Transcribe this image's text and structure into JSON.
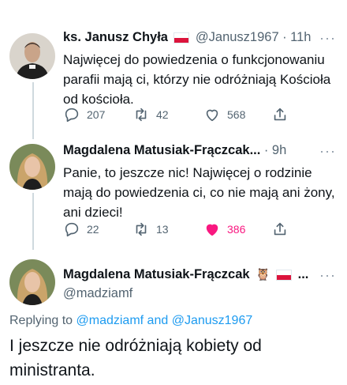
{
  "tweets": [
    {
      "name": "ks. Janusz Chyła",
      "handle": "@Janusz1967",
      "time": "· 11h",
      "text": "Najwięcej do powiedzenia o funkcjonowaniu parafii mają ci, którzy nie odróżniają Kościoła od kościoła.",
      "replies": "207",
      "retweets": "42",
      "likes": "568",
      "liked": false
    },
    {
      "name": "Magdalena Matusiak-Frączcak...",
      "time": "· 9h",
      "text": "Panie, to jeszcze nic! Najwięcej o rodzinie mają do powiedzenia ci, co nie mają ani żony, ani dzieci!",
      "replies": "22",
      "retweets": "13",
      "likes": "386",
      "liked": true
    }
  ],
  "main_tweet": {
    "name": "Magdalena Matusiak-Frączcak",
    "name_suffix": "...",
    "handle": "@madziamf",
    "replying_prefix": "Replying to",
    "replying_user1": "@madziamf",
    "replying_and": "and",
    "replying_user2": "@Janusz1967",
    "text": "I jeszcze nie odróżniają kobiety od ministranta."
  },
  "more_label": "···",
  "colors": {
    "text": "#0f1419",
    "secondary": "#536471",
    "link": "#1d9bf0",
    "like_active": "#f91880",
    "thread_line": "#cfd9de"
  },
  "icons": {
    "reply": "reply-icon",
    "retweet": "retweet-icon",
    "like": "heart-icon",
    "share": "share-icon",
    "flag": "poland-flag-icon",
    "owl": "owl-emoji-icon"
  }
}
